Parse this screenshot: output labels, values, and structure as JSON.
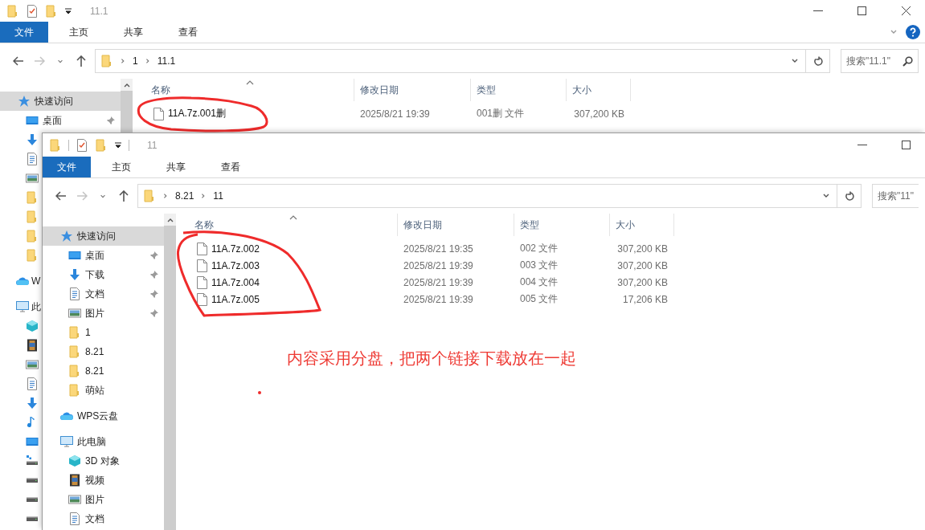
{
  "back_window": {
    "title": "11.1",
    "ribbon_tabs": [
      {
        "label": "文件",
        "selected": true
      },
      {
        "label": "主页",
        "selected": false
      },
      {
        "label": "共享",
        "selected": false
      },
      {
        "label": "查看",
        "selected": false
      }
    ],
    "address_path": [
      "1",
      "11.1"
    ],
    "search": {
      "placeholder": "搜索\"11.1\""
    },
    "sidebar": [
      {
        "label": "快速访问",
        "kind": "star",
        "selected": true,
        "children": [
          {
            "label": "桌面",
            "kind": "desktop",
            "pinned": true,
            "selected": false
          },
          {
            "kind": "download",
            "selected": false
          },
          {
            "kind": "document",
            "selected": false
          },
          {
            "kind": "picture",
            "selected": false
          },
          {
            "kind": "folder",
            "selected": false
          },
          {
            "kind": "folder",
            "selected": false
          },
          {
            "kind": "folder",
            "selected": false
          },
          {
            "kind": "folder",
            "selected": false
          }
        ]
      },
      {
        "label": "W",
        "kind": "cloud",
        "selected": false
      },
      {
        "label": "此",
        "kind": "computer",
        "selected": false,
        "children": [
          {
            "kind": "cube",
            "selected": false
          },
          {
            "kind": "film",
            "selected": false
          },
          {
            "kind": "picture",
            "selected": false
          },
          {
            "kind": "document",
            "selected": false
          },
          {
            "kind": "download",
            "selected": false
          },
          {
            "kind": "music",
            "selected": false
          },
          {
            "kind": "desktop",
            "selected": false
          },
          {
            "kind": "system-drive",
            "selected": false
          },
          {
            "kind": "drive",
            "selected": false
          },
          {
            "kind": "drive",
            "selected": false
          },
          {
            "kind": "drive",
            "selected": false
          }
        ]
      }
    ],
    "columns": [
      "名称",
      "修改日期",
      "类型",
      "大小"
    ],
    "rows": [
      {
        "name": "11A.7z.001删",
        "modified": "2025/8/21 19:39",
        "type": "001删 文件",
        "size": "307,200 KB",
        "selected": false
      }
    ]
  },
  "front_window": {
    "title": "11",
    "ribbon_tabs": [
      {
        "label": "文件",
        "selected": true
      },
      {
        "label": "主页",
        "selected": false
      },
      {
        "label": "共享",
        "selected": false
      },
      {
        "label": "查看",
        "selected": false
      }
    ],
    "address_path": [
      "8.21",
      "11"
    ],
    "search": {
      "placeholder": "搜索\"11\""
    },
    "sidebar": [
      {
        "label": "快速访问",
        "kind": "star",
        "selected": true,
        "children": [
          {
            "label": "桌面",
            "kind": "desktop",
            "pinned": true,
            "selected": false
          },
          {
            "label": "下载",
            "kind": "download",
            "pinned": true,
            "selected": false
          },
          {
            "label": "文档",
            "kind": "document",
            "pinned": true,
            "selected": false
          },
          {
            "label": "图片",
            "kind": "picture",
            "pinned": true,
            "selected": false
          },
          {
            "label": "1",
            "kind": "folder",
            "pinned": false,
            "selected": false
          },
          {
            "label": "8.21",
            "kind": "folder",
            "pinned": false,
            "selected": false
          },
          {
            "label": "8.21",
            "kind": "folder",
            "pinned": false,
            "selected": false
          },
          {
            "label": "萌站",
            "kind": "folder",
            "pinned": false,
            "selected": false
          }
        ]
      },
      {
        "label": "WPS云盘",
        "kind": "cloud",
        "selected": false
      },
      {
        "label": "此电脑",
        "kind": "computer",
        "selected": false,
        "children": [
          {
            "label": "3D 对象",
            "kind": "cube",
            "selected": false
          },
          {
            "label": "视频",
            "kind": "film",
            "selected": false
          },
          {
            "label": "图片",
            "kind": "picture",
            "selected": false
          },
          {
            "label": "文档",
            "kind": "document",
            "selected": false
          }
        ]
      }
    ],
    "columns": [
      "名称",
      "修改日期",
      "类型",
      "大小"
    ],
    "rows": [
      {
        "name": "11A.7z.002",
        "modified": "2025/8/21 19:35",
        "type": "002 文件",
        "size": "307,200 KB",
        "selected": false
      },
      {
        "name": "11A.7z.003",
        "modified": "2025/8/21 19:39",
        "type": "003 文件",
        "size": "307,200 KB",
        "selected": false
      },
      {
        "name": "11A.7z.004",
        "modified": "2025/8/21 19:39",
        "type": "004 文件",
        "size": "307,200 KB",
        "selected": false
      },
      {
        "name": "11A.7z.005",
        "modified": "2025/8/21 19:39",
        "type": "005 文件",
        "size": "17,206 KB",
        "selected": false
      }
    ]
  },
  "annotation": {
    "text": "内容采用分盘，把两个链接下载放在一起"
  }
}
